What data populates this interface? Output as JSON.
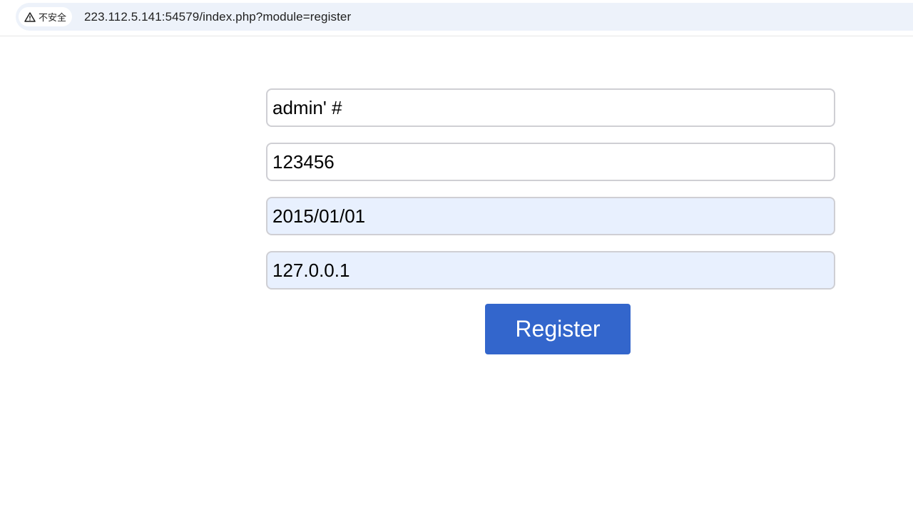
{
  "browser": {
    "security_label": "不安全",
    "url": "223.112.5.141:54579/index.php?module=register",
    "security_icon": "warning-triangle-icon"
  },
  "form": {
    "fields": [
      {
        "value": "admin' #",
        "autofilled": false
      },
      {
        "value": "123456",
        "autofilled": false
      },
      {
        "value": "2015/01/01",
        "autofilled": true
      },
      {
        "value": "127.0.0.1",
        "autofilled": true
      }
    ],
    "register_label": "Register"
  },
  "colors": {
    "button_bg": "#3366cc",
    "autofill_bg": "#e8f0fe",
    "omnibox_bg": "#edf2fa"
  }
}
